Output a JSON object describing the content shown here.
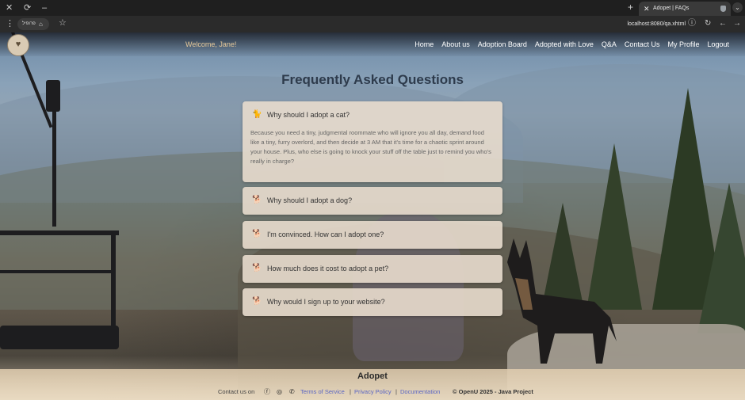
{
  "browser": {
    "tab_title": "Adopet | FAQs",
    "tab_close": "✕",
    "new_tab": "+",
    "close_window": "✕",
    "reload": "⟳",
    "minimize": "–",
    "profile_chip": "פרופיל",
    "url": "localhost:8080/qa.xhtml",
    "site_info_icon": "ⓘ"
  },
  "nav": {
    "welcome": "Welcome, Jane!",
    "links": [
      "Home",
      "About us",
      "Adoption Board",
      "Adopted with Love",
      "Q&A",
      "Contact Us",
      "My Profile",
      "Logout"
    ]
  },
  "page": {
    "title": "Frequently Asked Questions",
    "faqs": [
      {
        "question": "Why should I adopt a cat?",
        "icon": "cat-icon",
        "expanded": true,
        "answer": "Because you need a tiny, judgmental roommate who will ignore you all day, demand food like a tiny, furry overlord, and then decide at 3 AM that it's time for a chaotic sprint around your house. Plus, who else is going to knock your stuff off the table just to remind you who's really in charge?"
      },
      {
        "question": "Why should I adopt a dog?",
        "icon": "dog-icon",
        "expanded": false
      },
      {
        "question": "I'm convinced. How can I adopt one?",
        "icon": "dog-icon",
        "expanded": false
      },
      {
        "question": "How much does it cost to adopt a pet?",
        "icon": "dog-icon",
        "expanded": false
      },
      {
        "question": "Why would I sign up to your website?",
        "icon": "dog-icon",
        "expanded": false
      }
    ]
  },
  "footer": {
    "brand": "Adopet",
    "contact_label": "Contact us on",
    "social_icons": [
      "facebook-icon",
      "instagram-icon",
      "whatsapp-icon"
    ],
    "links": [
      "Terms of Service",
      "Privacy Policy",
      "Documentation"
    ],
    "separator": "|",
    "copyright": "© OpenU 2025 - Java Project"
  },
  "colors": {
    "nav_text": "#ffffff",
    "welcome_text": "#e6c99a",
    "title_text": "#2e3b4c",
    "footer_link": "#5b66c4"
  }
}
